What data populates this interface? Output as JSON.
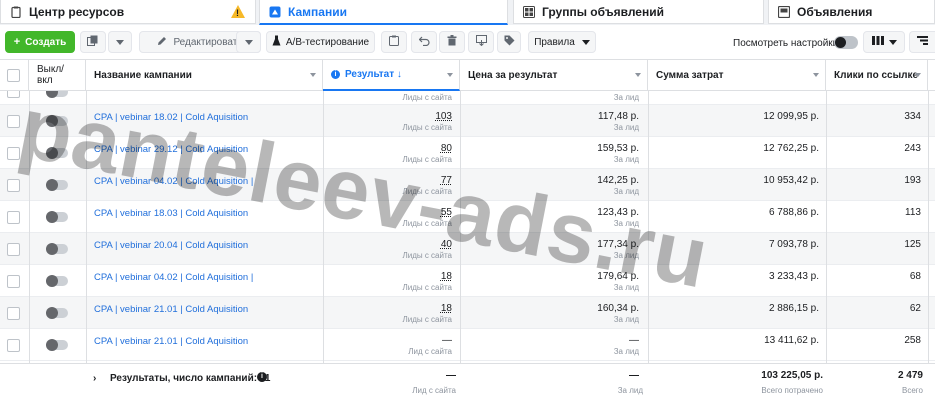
{
  "tabs": [
    {
      "label": "Центр ресурсов",
      "icon": "clipboard-icon"
    },
    {
      "label": "Кампании",
      "icon": "campaigns-icon"
    },
    {
      "label": "Группы объявлений",
      "icon": "grid-icon"
    },
    {
      "label": "Объявления",
      "icon": "ad-icon"
    }
  ],
  "warning_glyph": "!",
  "toolbar": {
    "create_label": "Создать",
    "edit_label": "Редактировать",
    "ab_label": "A/B-тестирование",
    "rules_label": "Правила",
    "settings_label": "Посмотреть настройки"
  },
  "columns": {
    "toggle": "Выкл/\nвкл",
    "name": "Название кампании",
    "result": "Результат ↓",
    "cost": "Цена за результат",
    "spend": "Сумма затрат",
    "clicks": "Клики по ссылке"
  },
  "top_partial": {
    "result_sub": "Лиды с сайта",
    "cost_sub": "За лид"
  },
  "rows": [
    {
      "name": "CPA | vebinar 18.02 | Cold Aquisition",
      "result": "103",
      "result_sub": "Лиды с сайта",
      "cost": "117,48 р.",
      "cost_sub": "За лид",
      "spend": "12 099,95 р.",
      "clicks": "334"
    },
    {
      "name": "CPA | vebinar 29.12 | Cold Aquisition",
      "result": "80",
      "result_sub": "Лиды с сайта",
      "cost": "159,53 р.",
      "cost_sub": "За лид",
      "spend": "12 762,25 р.",
      "clicks": "243"
    },
    {
      "name": "CPA | vebinar 04.02 | Cold Aquisition |",
      "result": "77",
      "result_sub": "Лиды с сайта",
      "cost": "142,25 р.",
      "cost_sub": "За лид",
      "spend": "10 953,42 р.",
      "clicks": "193"
    },
    {
      "name": "CPA | vebinar 18.03 | Cold Aquisition",
      "result": "55",
      "result_sub": "Лиды с сайта",
      "cost": "123,43 р.",
      "cost_sub": "За лид",
      "spend": "6 788,86 р.",
      "clicks": "113"
    },
    {
      "name": "CPA | vebinar 20.04 | Cold Aquisition",
      "result": "40",
      "result_sub": "Лиды с сайта",
      "cost": "177,34 р.",
      "cost_sub": "За лид",
      "spend": "7 093,78 р.",
      "clicks": "125"
    },
    {
      "name": "CPA | vebinar 04.02 | Cold Aquisition |",
      "result": "18",
      "result_sub": "Лиды с сайта",
      "cost": "179,64 р.",
      "cost_sub": "За лид",
      "spend": "3 233,43 р.",
      "clicks": "68"
    },
    {
      "name": "CPA | vebinar 21.01 | Cold Aquisition",
      "result": "18",
      "result_sub": "Лиды с сайта",
      "cost": "160,34 р.",
      "cost_sub": "За лид",
      "spend": "2 886,15 р.",
      "clicks": "62"
    },
    {
      "name": "CPA | vebinar 21.01 | Cold Aquisition",
      "result": "—",
      "result_sub": "Лид с сайта",
      "cost": "—",
      "cost_sub": "За лид",
      "spend": "13 411,62 р.",
      "clicks": "258"
    }
  ],
  "totals": {
    "label": "Результаты, число кампаний: 11",
    "info": "i",
    "result": "—",
    "result_sub": "Лид с сайта",
    "cost": "—",
    "cost_sub": "За лид",
    "spend": "103 225,05 р.",
    "spend_sub": "Всего потрачено",
    "clicks": "2 479",
    "clicks_sub": "Всего"
  },
  "watermark": "panteleev-ads.ru"
}
